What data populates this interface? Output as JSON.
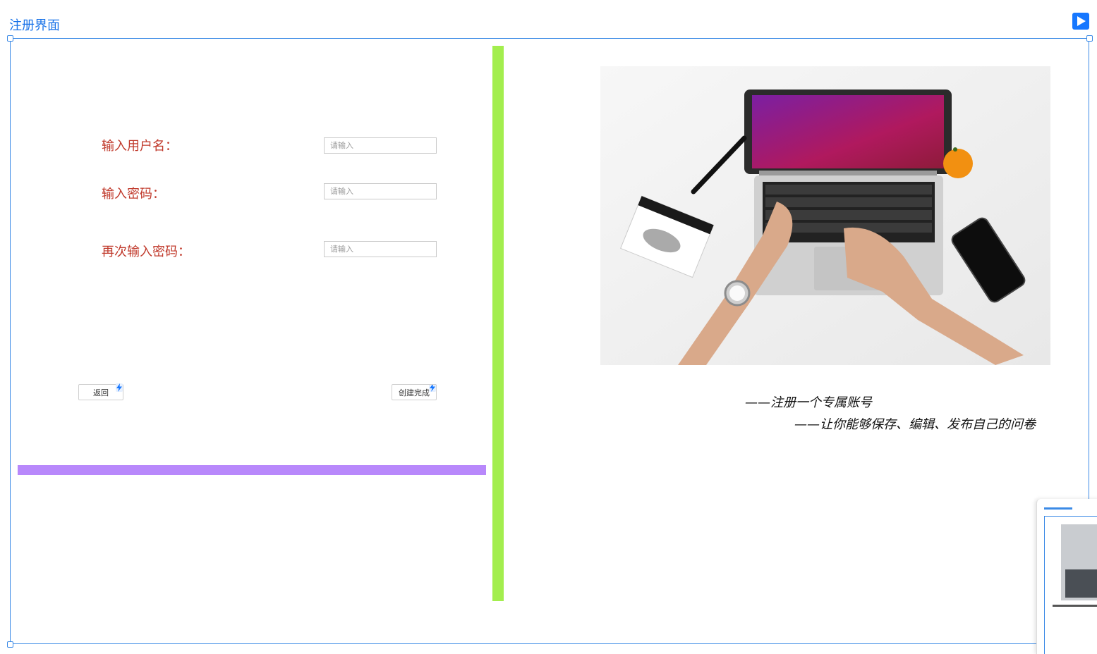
{
  "frame": {
    "title": "注册界面",
    "play_icon": "play-icon"
  },
  "form": {
    "username_label": "输入用户名：",
    "password_label": "输入密码：",
    "confirm_label": "再次输入密码：",
    "input_placeholder": "请输入"
  },
  "buttons": {
    "back_label": "返回",
    "create_label": "创建完成"
  },
  "captions": {
    "line1": "——注册一个专属账号",
    "line2": "——让你能够保存、编辑、发布自己的问卷"
  },
  "colors": {
    "accent": "#1677ff",
    "frame_border": "#3b8ae6",
    "label": "#c0392b",
    "divider_green": "#a3ee4e",
    "divider_purple": "#b888fb"
  }
}
